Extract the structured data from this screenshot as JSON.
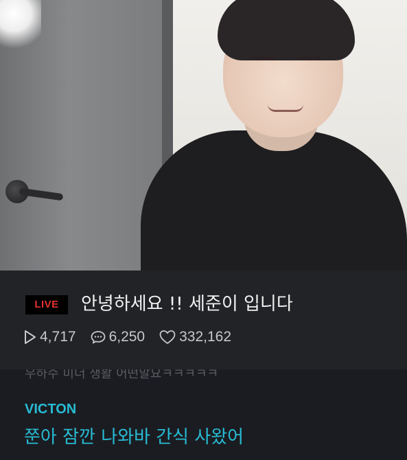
{
  "broadcast": {
    "live_label": "LIVE",
    "title": "안녕하세요 !!  세준이 입니다",
    "stats": {
      "views": "4,717",
      "comments": "6,250",
      "likes": "332,162"
    }
  },
  "chat": {
    "faded_message": "우하수 미더 생활 어떤말요ㅋㅋㅋㅋㅋ",
    "channel_name": "VICTON",
    "message": "쭌아 잠깐 나와바 간식 사왔어"
  },
  "colors": {
    "live_red": "#e5322d",
    "accent_cyan": "#27bcd4",
    "card_bg": "#222327",
    "page_bg": "#1b1c21"
  },
  "icons": [
    "play-icon",
    "comment-icon",
    "heart-icon"
  ]
}
